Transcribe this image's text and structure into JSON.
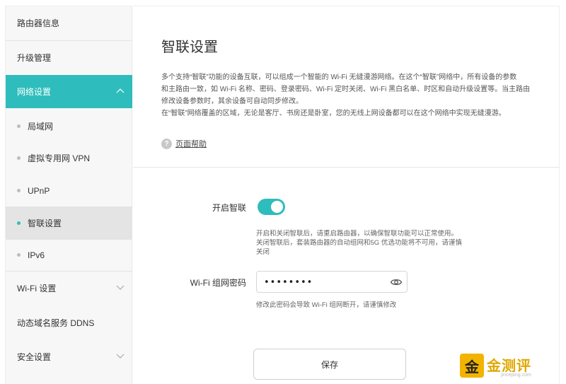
{
  "sidebar": {
    "items": [
      {
        "label": "路由器信息"
      },
      {
        "label": "升级管理"
      },
      {
        "label": "网络设置"
      },
      {
        "label": "局域网"
      },
      {
        "label": "虚拟专用网 VPN"
      },
      {
        "label": "UPnP"
      },
      {
        "label": "智联设置"
      },
      {
        "label": "IPv6"
      },
      {
        "label": "Wi-Fi 设置"
      },
      {
        "label": "动态域名服务 DDNS"
      },
      {
        "label": "安全设置"
      }
    ]
  },
  "main": {
    "title": "智联设置",
    "description": [
      "多个支持“智联”功能的设备互联，可以组成一个智能的 Wi-Fi 无缝漫游网络。在这个“智联”网络中，所有设备的参数",
      "和主路由一致，如 Wi-Fi 名称、密码、登录密码、Wi-Fi 定时关闭、Wi-Fi 黑白名单、时区和自动升级设置等。当主路由",
      "修改设备参数时，其余设备可自动同步修改。",
      "在“智联”网络覆盖的区域，无论是客厅、书房还是卧室，您的无线上网设备都可以在这个网络中实现无缝漫游。"
    ],
    "help_label": "页面帮助",
    "smart_link": {
      "label": "开启智联",
      "enabled": true,
      "hint": [
        "开启和关闭智联后，请重启路由器，以确保智联功能可以正常使用。",
        "关闭智联后，套装路由器的自动组网和5G 优选功能将不可用，请谨慎",
        "关闭"
      ]
    },
    "wifi_password": {
      "label": "Wi-Fi 组网密码",
      "value": "••••••••",
      "hint": "修改此密码会导致 Wi-Fi 组网断开，请谨慎修改"
    },
    "save_label": "保存"
  },
  "watermark": {
    "badge": "金",
    "text": "金测评",
    "sub": "jinceping.com"
  },
  "colors": {
    "accent": "#2ebdbc",
    "sidebar_bg": "#f7f7f7",
    "selected_bg": "#e4e4e4"
  }
}
